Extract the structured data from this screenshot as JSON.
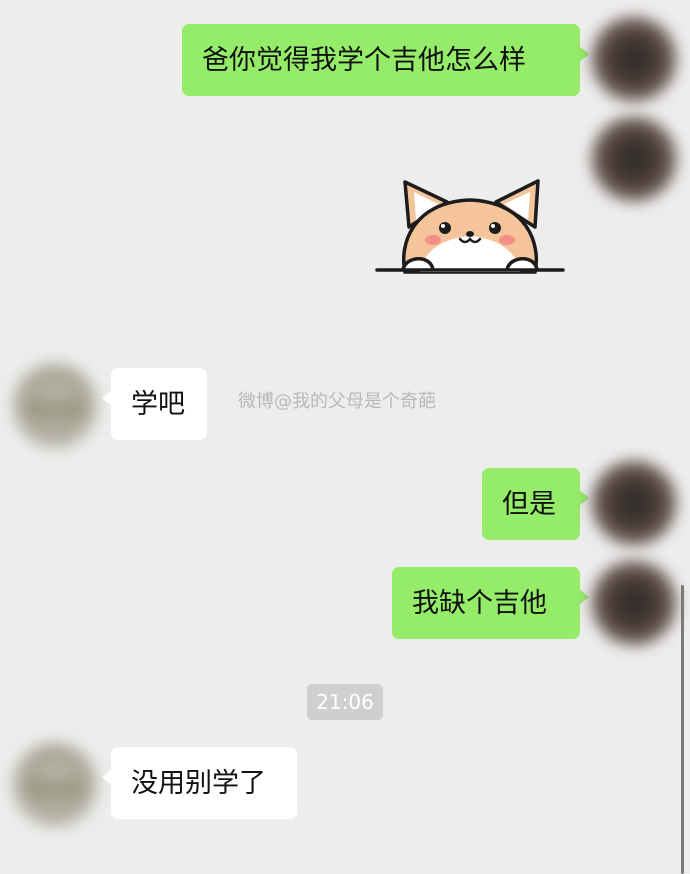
{
  "messages": [
    {
      "side": "right",
      "text": "爸你觉得我学个吉他怎么样"
    },
    {
      "side": "right",
      "sticker": "cat-peeking-sticker"
    },
    {
      "side": "left",
      "text": "学吧"
    },
    {
      "side": "right",
      "text": "但是"
    },
    {
      "side": "right",
      "text": "我缺个吉他"
    },
    {
      "type": "timestamp",
      "text": "21:06"
    },
    {
      "side": "left",
      "text": "没用别学了"
    }
  ],
  "watermark": "微博@我的父母是个奇葩",
  "colors": {
    "background": "#ededed",
    "sent_bubble": "#95ec69",
    "received_bubble": "#ffffff",
    "timestamp_chip": "#cfcfcf"
  }
}
